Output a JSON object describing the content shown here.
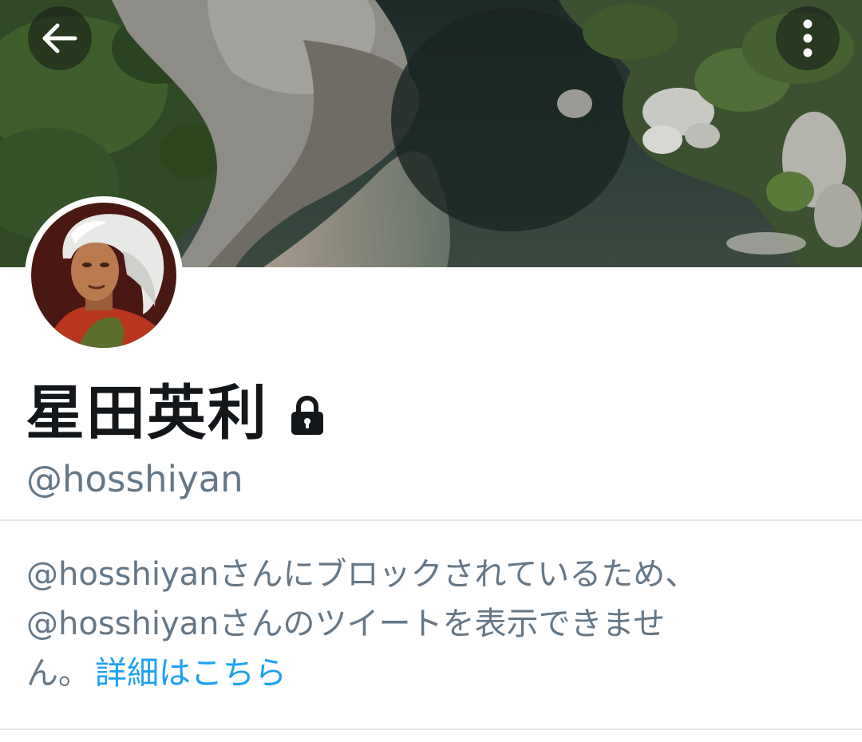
{
  "header": {
    "back_icon": "arrow-left-icon",
    "more_icon": "more-vertical-icon",
    "overlay_button_color": "#141814"
  },
  "banner": {
    "subject": "river gorge photo"
  },
  "profile": {
    "display_name": "星田英利",
    "protected_icon": "lock-icon",
    "handle": "@hosshiyan"
  },
  "blocked_notice": {
    "line1": "@hosshiyanさんにブロックされているため、",
    "line2": "@hosshiyanさんのツイートを表示できませ",
    "line3": "ん。",
    "learn_more_label": "詳細はこちら"
  },
  "colors": {
    "primary_text": "#14171a",
    "secondary_text": "#657786",
    "link": "#1da1f2",
    "divider": "#e1e8ed"
  }
}
